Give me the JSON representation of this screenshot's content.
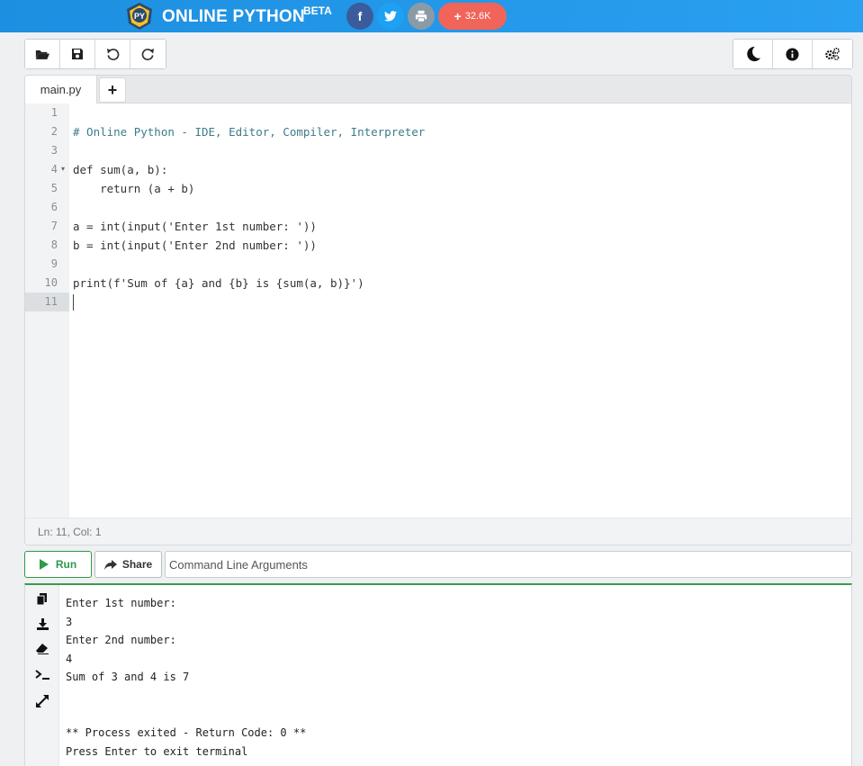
{
  "header": {
    "brand": "ONLINE PYTHON",
    "beta": "BETA",
    "logo_text": "PY",
    "share_count": "32.6K",
    "colors": {
      "bar": "#1d8fe0",
      "facebook": "#3b5c9c",
      "twitter": "#1da1f2",
      "print": "#8a9ba6",
      "share": "#f0645a"
    }
  },
  "toolbar": {
    "left_icons": [
      "folder-open-icon",
      "save-icon",
      "undo-icon",
      "redo-icon"
    ],
    "right_icons": [
      "dark-mode-moon-icon",
      "info-icon",
      "settings-gears-icon"
    ]
  },
  "editor": {
    "tab_label": "main.py",
    "add_tab_label": "+",
    "lines": [
      {
        "n": "1",
        "text": ""
      },
      {
        "n": "2",
        "text": "# Online Python - IDE, Editor, Compiler, Interpreter"
      },
      {
        "n": "3",
        "text": ""
      },
      {
        "n": "4",
        "text": "def sum(a, b):"
      },
      {
        "n": "5",
        "text": "    return (a + b)"
      },
      {
        "n": "6",
        "text": ""
      },
      {
        "n": "7",
        "text": "a = int(input('Enter 1st number: '))"
      },
      {
        "n": "8",
        "text": "b = int(input('Enter 2nd number: '))"
      },
      {
        "n": "9",
        "text": ""
      },
      {
        "n": "10",
        "text": "print(f'Sum of {a} and {b} is {sum(a, b)}')"
      },
      {
        "n": "11",
        "text": ""
      }
    ],
    "status": "Ln: 11,  Col: 1"
  },
  "run_row": {
    "run_label": "Run",
    "share_label": "Share",
    "args_placeholder": "Command Line Arguments"
  },
  "terminal": {
    "icons": [
      "copy-icon",
      "download-icon",
      "eraser-icon",
      "terminal-prompt-icon",
      "expand-icon"
    ],
    "lines": [
      "Enter 1st number:",
      "3",
      "Enter 2nd number:",
      "4",
      "Sum of 3 and 4 is 7",
      "",
      "",
      "** Process exited - Return Code: 0 **",
      "Press Enter to exit terminal"
    ]
  }
}
